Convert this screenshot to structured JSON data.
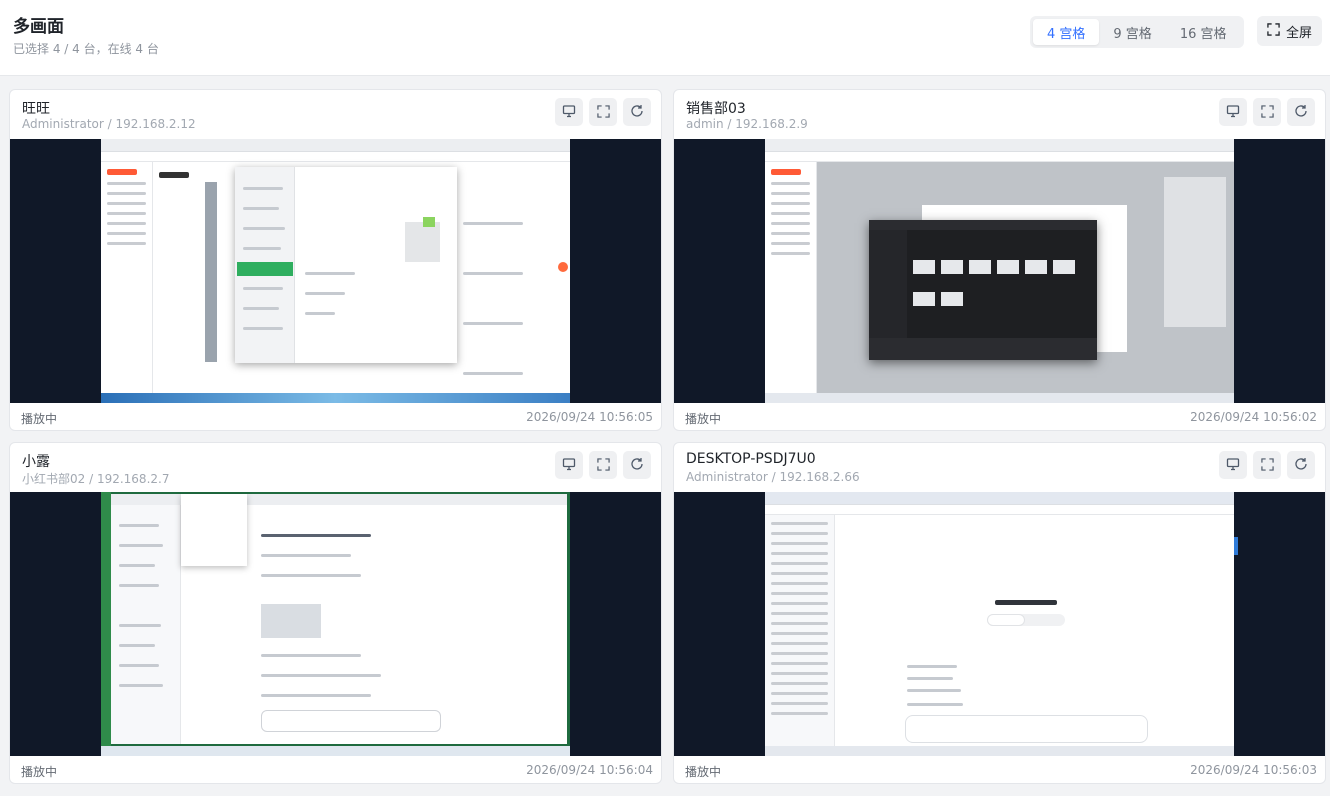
{
  "page": {
    "title": "多画面",
    "subtitle": "已选择 4 / 4 台，在线 4 台"
  },
  "layout_options": [
    {
      "label": "4 宫格",
      "active": true
    },
    {
      "label": "9 宫格",
      "active": false
    },
    {
      "label": "16 宫格",
      "active": false
    }
  ],
  "fullscreen_label": "全屏",
  "cards": [
    {
      "name": "旺旺",
      "user": "Administrator",
      "ip": "192.168.2.12",
      "sub": "Administrator / 192.168.2.12",
      "status": "播放中",
      "time": "2026/09/24 10:56:05"
    },
    {
      "name": "销售部03",
      "user": "admin",
      "ip": "192.168.2.9",
      "sub": "admin / 192.168.2.9",
      "status": "播放中",
      "time": "2026/09/24 10:56:02"
    },
    {
      "name": "小露",
      "user": "小红书部02",
      "ip": "192.168.2.7",
      "sub": "小红书部02 / 192.168.2.7",
      "status": "播放中",
      "time": "2026/09/24 10:56:04"
    },
    {
      "name": "DESKTOP-PSDJ7U0",
      "user": "Administrator",
      "ip": "192.168.2.66",
      "sub": "Administrator / 192.168.2.66",
      "status": "播放中",
      "time": "2026/09/24 10:56:03"
    }
  ],
  "card_actions": [
    "monitor-icon",
    "expand-icon",
    "refresh-icon"
  ],
  "colors": {
    "accent": "#3370ff",
    "stage_bg": "#101828"
  }
}
